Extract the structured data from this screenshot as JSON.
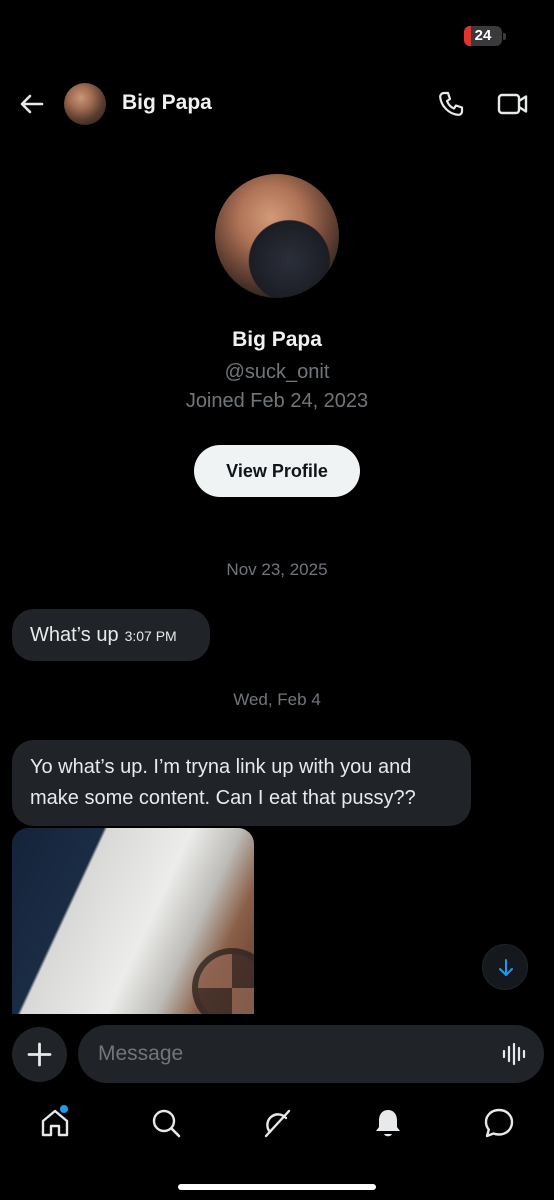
{
  "status_bar": {
    "battery_level": "24"
  },
  "header": {
    "contact_name": "Big Papa",
    "back_icon": "arrow-left-icon",
    "call_icon": "phone-icon",
    "video_icon": "video-camera-icon"
  },
  "profile": {
    "name": "Big Papa",
    "handle": "@suck_onit",
    "joined": "Joined Feb 24, 2023",
    "view_profile_label": "View Profile"
  },
  "conversation": {
    "date_separators": [
      "Nov 23, 2025",
      "Wed, Feb 4"
    ],
    "messages": [
      {
        "text": "What’s up",
        "time": "3:07 PM"
      },
      {
        "text": "Yo what’s up. I’m tryna link up with you and make some content. Can I eat that pussy??"
      }
    ]
  },
  "composer": {
    "placeholder": "Message",
    "plus_icon": "plus-icon",
    "voice_icon": "voice-wave-icon"
  },
  "bottom_nav": {
    "items": [
      "home-icon",
      "search-icon",
      "grok-icon",
      "notifications-bell-icon",
      "messages-icon"
    ]
  },
  "colors": {
    "background": "#000000",
    "bubble": "#202327",
    "secondary_text": "#71767b",
    "accent": "#1d9bf0"
  }
}
